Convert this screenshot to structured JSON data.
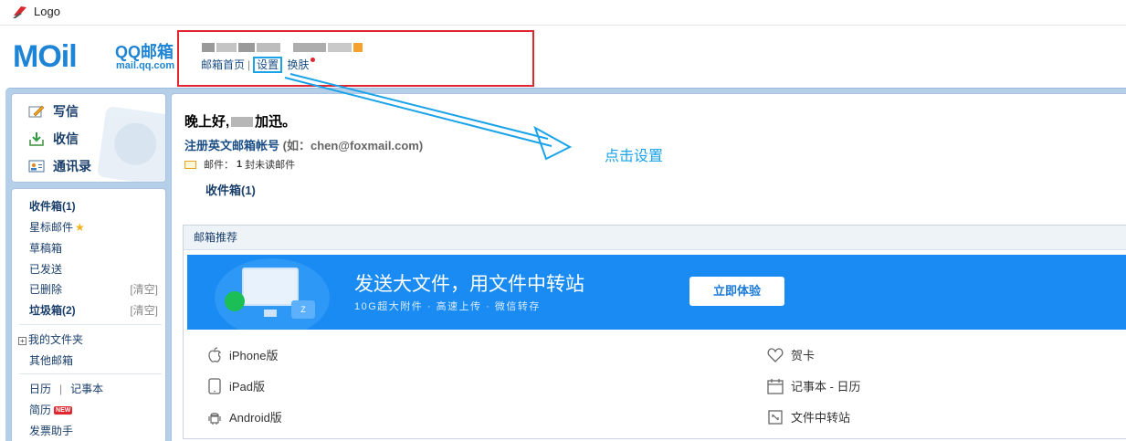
{
  "topbar": {
    "logo_text": "Logo"
  },
  "brand": {
    "mail": "MOil",
    "qq": "QQ邮箱",
    "domain": "mail.qq.com"
  },
  "user_links": {
    "home": "邮箱首页",
    "sep": "|",
    "settings": "设置",
    "skin": "换肤"
  },
  "sidebar": {
    "actions": [
      {
        "label": "写信",
        "icon": "pencil-icon"
      },
      {
        "label": "收信",
        "icon": "inbox-download-icon"
      },
      {
        "label": "通讯录",
        "icon": "contact-card-icon"
      }
    ],
    "inbox": "收件箱(1)",
    "starred": "星标邮件",
    "drafts": "草稿箱",
    "sent": "已发送",
    "deleted": "已删除",
    "deleted_clear": "[清空]",
    "spam": "垃圾箱(2)",
    "spam_clear": "[清空]",
    "my_folders": "我的文件夹",
    "other_mailbox": "其他邮箱",
    "calendar": "日历",
    "cal_sep": "|",
    "notebook": "记事本",
    "resume": "简历",
    "resume_badge": "NEW",
    "invoice": "发票助手"
  },
  "main": {
    "greeting_start": "晚上好,",
    "greeting_end": "加迅。",
    "register": "注册英文邮箱帐号",
    "register_hint": "(如：chen@foxmail.com)",
    "unread_prefix": "邮件：",
    "unread_count": "1",
    "unread_suffix": "封未读邮件",
    "inbox_link": "收件箱(1)"
  },
  "annotation": {
    "text": "点击设置"
  },
  "recommend": {
    "header": "邮箱推荐",
    "banner_title": "发送大文件，用文件中转站",
    "banner_sub": "10G超大附件 · 高速上传 · 微信转存",
    "banner_button": "立即体验",
    "platforms": [
      {
        "label": "iPhone版",
        "icon": "apple-icon"
      },
      {
        "label": "iPad版",
        "icon": "tablet-icon"
      },
      {
        "label": "Android版",
        "icon": "android-icon"
      }
    ],
    "services": [
      {
        "label": "贺卡",
        "icon": "heart-icon"
      },
      {
        "label": "记事本 - 日历",
        "icon": "calendar-icon"
      },
      {
        "label": "文件中转站",
        "icon": "file-transfer-icon"
      }
    ]
  },
  "colors": {
    "brand_blue": "#1d84d6",
    "highlight_red": "#e0262e",
    "annotation_cyan": "#1aa3e8",
    "banner_blue": "#1a8bf2"
  }
}
